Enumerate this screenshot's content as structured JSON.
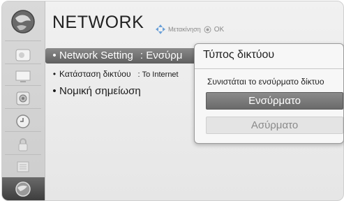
{
  "header": {
    "title": "NETWORK",
    "hint_move": "Μετακίνηση",
    "hint_ok": "OK"
  },
  "sidebar": {
    "icons": [
      "globe-icon",
      "picture-icon",
      "screen-icon",
      "audio-icon",
      "clock-icon",
      "lock-icon",
      "options-icon",
      "network-icon"
    ],
    "selected_index": 7
  },
  "menu": {
    "items": [
      {
        "label": "Network Setting",
        "value": ": Ενσύρμ"
      },
      {
        "label": "Κατάσταση δικτύου",
        "value": ": To Internet"
      },
      {
        "label": "Νομική σημείωση",
        "value": ""
      }
    ],
    "selected_index": 0
  },
  "popup": {
    "title": "Τύπος δικτύου",
    "message": "Συνιστάται το ενσύρματο δίκτυο",
    "options": [
      "Ενσύρματο",
      "Ασύρματο"
    ],
    "selected_index": 0
  },
  "colors": {
    "selected_bg": "#6f6f6f",
    "panel_bg": "#ececec",
    "sidebar_bg": "#d4d4d4"
  }
}
